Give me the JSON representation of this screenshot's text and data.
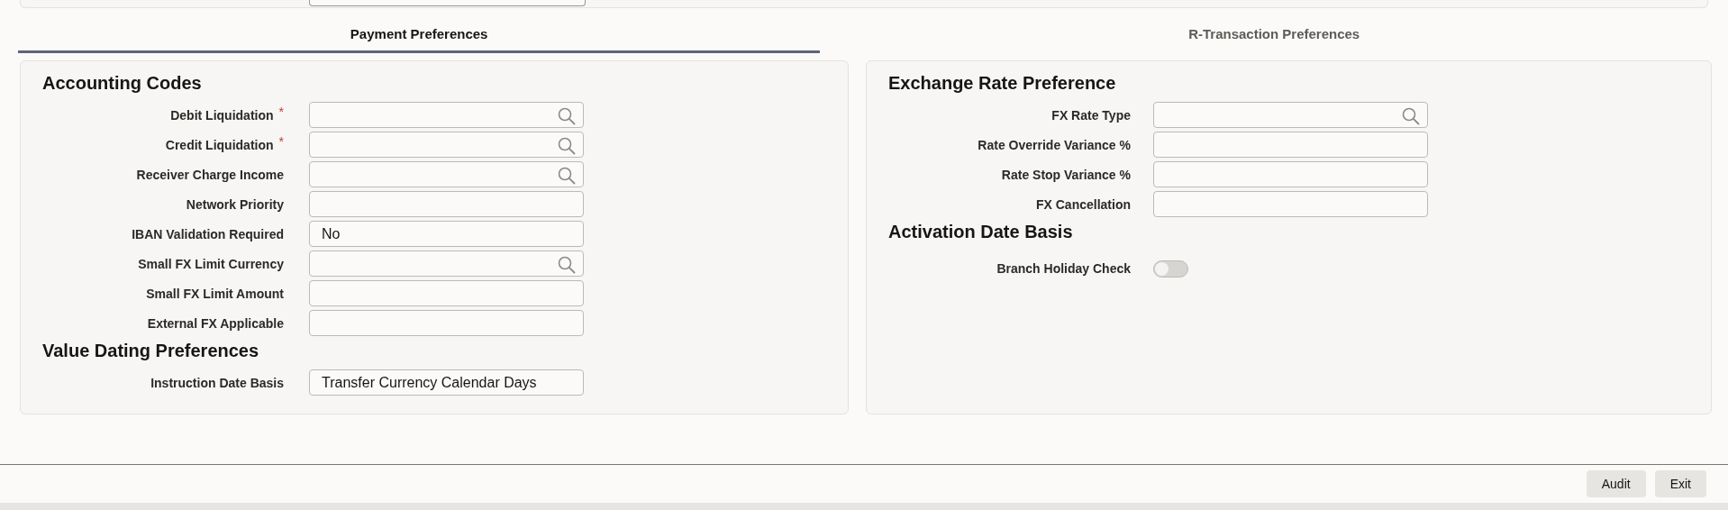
{
  "tabs": [
    {
      "label": "Payment Preferences",
      "selected": true
    },
    {
      "label": "R-Transaction Preferences",
      "selected": false
    }
  ],
  "panels": [
    {
      "sections": [
        {
          "title": "Accounting Codes",
          "fields": [
            {
              "kind": "lookup",
              "label": "Debit Liquidation",
              "marker": "*"
            },
            {
              "kind": "lookup",
              "label": "Credit Liquidation",
              "marker": "*"
            },
            {
              "kind": "lookup",
              "label": "Receiver Charge Income"
            },
            {
              "kind": "text",
              "label": "Network Priority"
            },
            {
              "kind": "text",
              "label": "IBAN Validation Required",
              "value": "No"
            },
            {
              "kind": "lookup",
              "label": "Small FX Limit Currency"
            },
            {
              "kind": "text",
              "label": "Small FX Limit Amount"
            },
            {
              "kind": "text",
              "label": "External FX Applicable"
            }
          ]
        },
        {
          "title": "Value Dating Preferences",
          "fields": [
            {
              "kind": "text",
              "label": "Instruction Date Basis",
              "value": "Transfer Currency Calendar Days"
            }
          ]
        }
      ]
    },
    {
      "sections": [
        {
          "title": "Exchange Rate Preference",
          "fields": [
            {
              "kind": "lookup",
              "label": "FX Rate Type"
            },
            {
              "kind": "text",
              "label": "Rate Override Variance %"
            },
            {
              "kind": "text",
              "label": "Rate Stop Variance %"
            },
            {
              "kind": "text",
              "label": "FX Cancellation"
            }
          ]
        },
        {
          "title": "Activation Date Basis",
          "fields": [
            {
              "kind": "toggle",
              "label": "Branch Holiday Check",
              "on": false
            }
          ]
        }
      ]
    }
  ],
  "buttons": [
    "Audit",
    "Exit"
  ]
}
